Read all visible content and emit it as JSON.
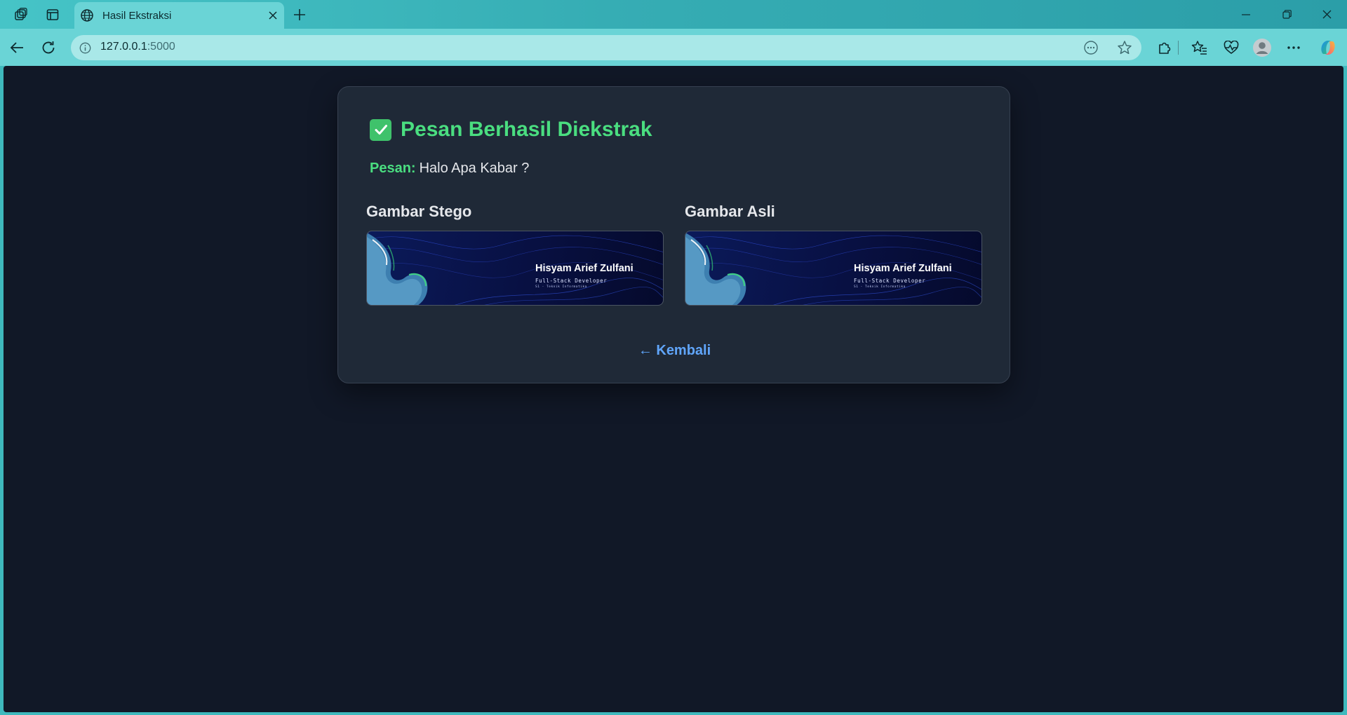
{
  "browser": {
    "tab_title": "Hasil Ekstraksi",
    "url_host": "127.0.0.1",
    "url_port": ":5000"
  },
  "page": {
    "heading": "Pesan Berhasil Diekstrak",
    "message_label": "Pesan:",
    "message_value": "Halo Apa Kabar ?",
    "stego_title": "Gambar Stego",
    "original_title": "Gambar Asli",
    "banner": {
      "name": "Hisyam Arief Zulfani",
      "role": "Full-Stack Developer",
      "sub": "S1 - Teknik Informatika"
    },
    "back_label": "← Kembali"
  },
  "colors": {
    "success": "#4ade80",
    "link": "#60a5fa",
    "page_bg": "#111827",
    "card_bg": "#1f2937"
  },
  "icons": [
    "workspaces-icon",
    "tab-actions-icon",
    "globe-icon",
    "close-icon",
    "plus-icon",
    "minimize-icon",
    "restore-icon",
    "back-icon",
    "reload-icon",
    "info-icon",
    "reader-icon",
    "star-icon",
    "extensions-icon",
    "favorites-icon",
    "health-icon",
    "profile-icon",
    "more-icon",
    "copilot-icon",
    "check-icon"
  ]
}
